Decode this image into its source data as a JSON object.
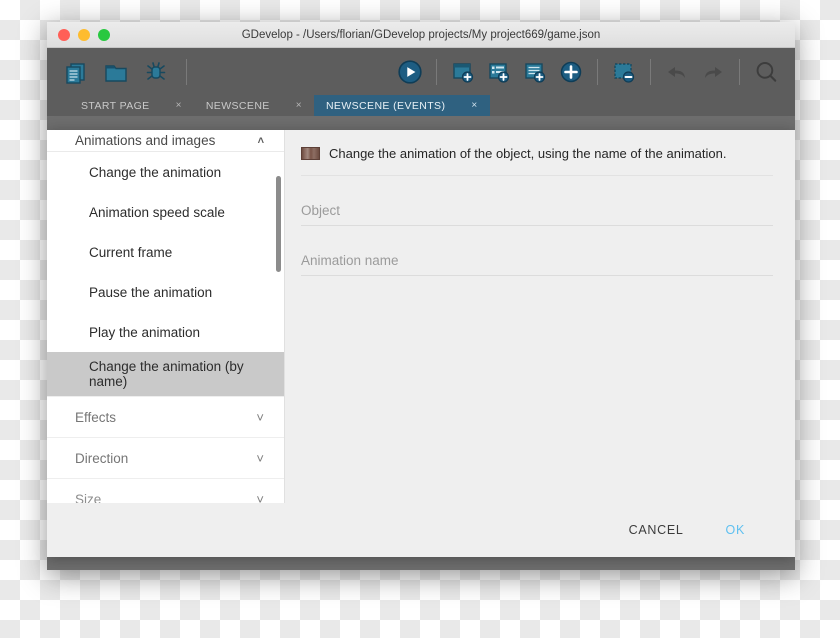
{
  "window": {
    "title": "GDevelop - /Users/florian/GDevelop projects/My project669/game.json",
    "traffic_lights": [
      "close",
      "minimize",
      "maximize"
    ]
  },
  "toolbar": {
    "left_buttons": [
      {
        "name": "new-project-icon",
        "label": "New project"
      },
      {
        "name": "open-project-icon",
        "label": "Open project"
      },
      {
        "name": "debug-icon",
        "label": "Debug"
      }
    ],
    "right_buttons": [
      {
        "name": "preview-play-icon",
        "label": "Preview"
      },
      {
        "name": "add-scene-icon",
        "label": "Add scene"
      },
      {
        "name": "add-external-layout-icon",
        "label": "Add external layout"
      },
      {
        "name": "add-external-events-icon",
        "label": "Add external events"
      },
      {
        "name": "add-object-icon",
        "label": "Add object"
      },
      {
        "name": "remove-scene-icon",
        "label": "Remove scene"
      },
      {
        "name": "undo-icon",
        "label": "Undo"
      },
      {
        "name": "redo-icon",
        "label": "Redo"
      },
      {
        "name": "search-icon",
        "label": "Search"
      }
    ]
  },
  "tabs": [
    {
      "label": "START PAGE",
      "close": "×",
      "active": false
    },
    {
      "label": "NEWSCENE",
      "close": "×",
      "active": false
    },
    {
      "label": "NEWSCENE (EVENTS)",
      "close": "×",
      "active": true
    }
  ],
  "dialog": {
    "list": {
      "header": {
        "label": "Animations and images",
        "chevron": "˄"
      },
      "items": [
        {
          "label": "Change the animation",
          "selected": false
        },
        {
          "label": "Animation speed scale",
          "selected": false
        },
        {
          "label": "Current frame",
          "selected": false
        },
        {
          "label": "Pause the animation",
          "selected": false
        },
        {
          "label": "Play the animation",
          "selected": false
        },
        {
          "label": "Change the animation (by name)",
          "selected": true
        }
      ],
      "groups": [
        {
          "label": "Effects",
          "chevron": "˅"
        },
        {
          "label": "Direction",
          "chevron": "˅"
        },
        {
          "label": "Size",
          "chevron": "˅"
        }
      ]
    },
    "parameters": {
      "icon": "sprite-thumbnail-icon",
      "description": "Change the animation of the object, using the name of the animation.",
      "fields": [
        {
          "name": "object",
          "placeholder": "Object",
          "value": ""
        },
        {
          "name": "animation-name",
          "placeholder": "Animation name",
          "value": ""
        }
      ]
    },
    "footer": {
      "cancel_label": "CANCEL",
      "ok_label": "OK"
    }
  },
  "colors": {
    "toolbar_bg": "#5d5d5d",
    "active_tab": "#2f6180",
    "selection": "#c9c9c9",
    "ok_accent": "#5fc0f0",
    "icon_blue": "#1d5d82"
  }
}
